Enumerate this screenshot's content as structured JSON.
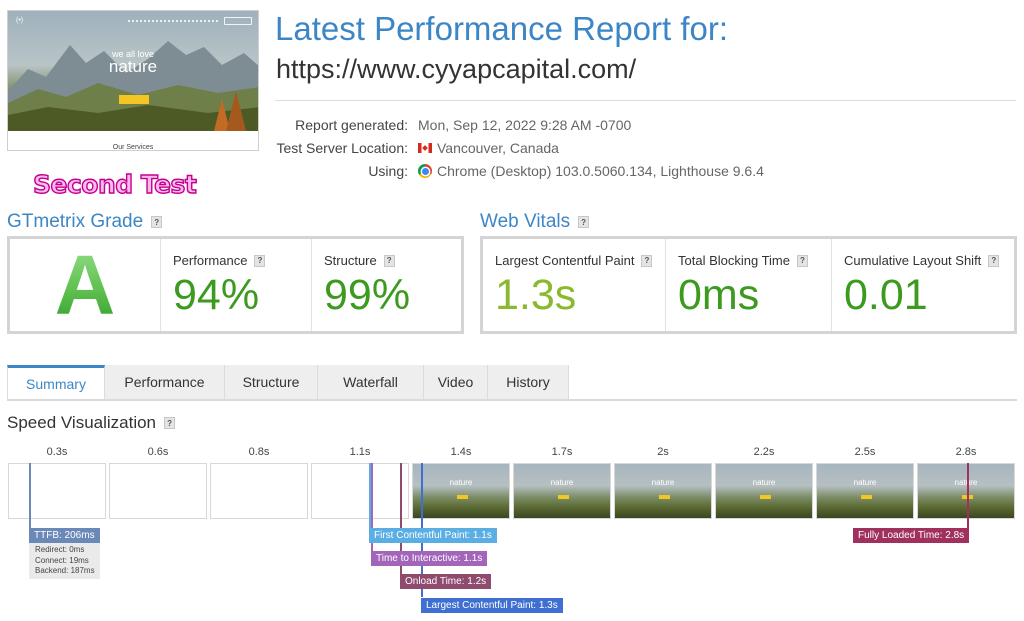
{
  "thumbnail": {
    "tagline": "we all love",
    "hero_word": "nature",
    "footer_text": "Our Services"
  },
  "report": {
    "title": "Latest Performance Report for:",
    "url": "https://www.cyyapcapital.com/",
    "meta": [
      {
        "label": "Report generated:",
        "value": "Mon, Sep 12, 2022 9:28 AM -0700",
        "icon": ""
      },
      {
        "label": "Test Server Location:",
        "value": "Vancouver, Canada",
        "icon": "canada-flag-icon"
      },
      {
        "label": "Using:",
        "value": "Chrome (Desktop) 103.0.5060.134, Lighthouse 9.6.4",
        "icon": "chrome-icon"
      }
    ]
  },
  "annotation": "Second Test",
  "gtmetrix": {
    "heading": "GTmetrix Grade",
    "help": "?",
    "grade": "A",
    "performance_label": "Performance",
    "performance_value": "94%",
    "structure_label": "Structure",
    "structure_value": "99%"
  },
  "web_vitals": {
    "heading": "Web Vitals",
    "help": "?",
    "lcp_label": "Largest Contentful Paint",
    "lcp_value": "1.3s",
    "tbt_label": "Total Blocking Time",
    "tbt_value": "0ms",
    "cls_label": "Cumulative Layout Shift",
    "cls_value": "0.01"
  },
  "tabs": [
    "Summary",
    "Performance",
    "Structure",
    "Waterfall",
    "Video",
    "History"
  ],
  "active_tab": "Summary",
  "speed": {
    "heading": "Speed Visualization",
    "help": "?",
    "ticks": [
      "0.3s",
      "0.6s",
      "0.8s",
      "1.1s",
      "1.4s",
      "1.7s",
      "2s",
      "2.2s",
      "2.5s",
      "2.8s"
    ],
    "frame_word": "nature",
    "ttfb_label": "TTFB: 206ms",
    "ttfb_redirect": "Redirect: 0ms",
    "ttfb_connect": "Connect: 19ms",
    "ttfb_backend": "Backend: 187ms",
    "fcp_label": "First Contentful Paint: 1.1s",
    "tti_label": "Time to Interactive: 1.1s",
    "onload_label": "Onload Time: 1.2s",
    "lcp_label": "Largest Contentful Paint: 1.3s",
    "fully_loaded_label": "Fully Loaded Time: 2.8s"
  },
  "colors": {
    "accent": "#3d86c6",
    "good": "#3c9a1f",
    "lcp_good": "#8ab92d",
    "ttfb": "#6b89b8",
    "fcp": "#5aaee3",
    "tti": "#a265ba",
    "onload": "#8e4b6d",
    "lcp": "#3f6fd0",
    "fully_loaded": "#a0305e"
  }
}
